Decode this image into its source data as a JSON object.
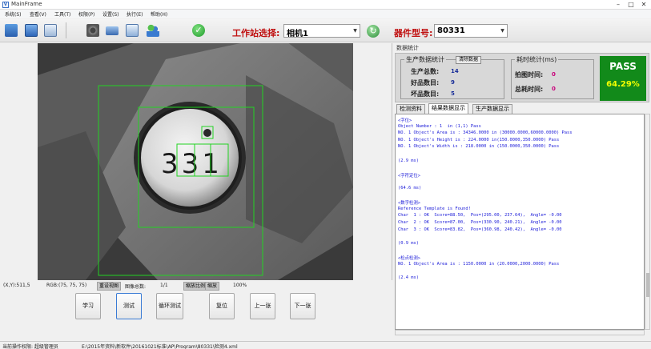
{
  "window": {
    "title": "MainFrame"
  },
  "menu": [
    "系统(S)",
    "查看(V)",
    "工具(T)",
    "权限(P)",
    "设置(S)",
    "执行(E)",
    "帮助(H)"
  ],
  "toolbar": {
    "station_label": "工作站选择:",
    "station_value": "相机1",
    "device_label": "器件型号:",
    "device_value": "80331"
  },
  "image": {
    "digits": "331"
  },
  "status": {
    "coords": "(X,Y):511,5",
    "rgb": "RGB:(75, 75, 75)",
    "reset_btn": "重设视图",
    "images_label": "图像总数:",
    "page": "1/1",
    "ratio_label": "缩放比例",
    "zoom_label": "缩放",
    "zoom": "100%"
  },
  "buttons": {
    "learn": "学习",
    "test": "测试",
    "loop_test": "循环测试",
    "reset": "复位",
    "prev": "上一张",
    "next": "下一张"
  },
  "stats": {
    "title": "数据统计",
    "production_title": "生产数据统计",
    "clear_btn": "清除数据",
    "total_label": "生产总数:",
    "total_value": "14",
    "good_label": "好品数目:",
    "good_value": "9",
    "bad_label": "坏品数目:",
    "bad_value": "5",
    "time_title": "耗时统计(ms)",
    "shot_label": "拍图时间:",
    "shot_value": "0",
    "total_time_label": "总耗时间:",
    "total_time_value": "0",
    "result": "PASS",
    "yield": "64.29%"
  },
  "tabs": [
    "检测资料",
    "结果数据显示",
    "生产数据显示"
  ],
  "log": [
    "<字位>",
    "Object Number : 1  in (1,1) Pass",
    "NO. 1 Object's Area is : 34346.0000 in (30000.0000,60000.0000) Pass",
    "NO. 1 Object's Height is : 224.0000 in(150.0000,350.0000) Pass",
    "NO. 1 Object's Width is : 218.0000 in (150.0000,350.0000) Pass",
    "",
    "(2.9 ms)",
    "",
    "<字符定位>",
    "",
    "(64.6 ms)",
    "",
    "<数字检测>",
    "Reference Template is Found!",
    "Char  1 : OK  Score=88.50,  Pos=(295.00, 237.64),  Angle= -0.00",
    "Char  2 : OK  Score=87.00,  Pos=(330.90, 240.21),  Angle= -0.00",
    "Char  3 : OK  Score=83.82,  Pos=(360.98, 240.42),  Angle= -0.00",
    "",
    "(0.9 ms)",
    "",
    "<检点检测>",
    "NO. 1 Object's Area is : 1150.0000 in (20.0000,2000.0000) Pass",
    "",
    "(2.4 ms)"
  ],
  "bottom": {
    "permission": "当前操作权限: 超级管理员",
    "path": "E:\\2015年资料\\新软件\\20161021标准\\AP\\Program\\80331\\检测4.xml"
  },
  "colors": {
    "pass_bg": "#128a1a",
    "pass_pct": "#f2ff00",
    "label_red": "#c01010",
    "log_blue": "#1b1bd8",
    "roi_green": "#23d323"
  }
}
